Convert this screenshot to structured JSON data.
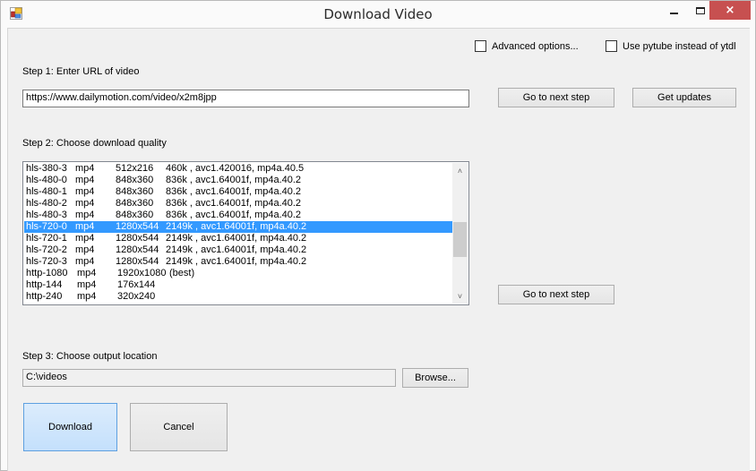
{
  "window": {
    "title": "Download Video",
    "controls": {
      "minimize": "minimize",
      "maximize": "maximize",
      "close": "×"
    },
    "icon": "app-icon"
  },
  "options": {
    "advanced_label": "Advanced options...",
    "advanced_checked": false,
    "pytube_label": "Use pytube instead of ytdl",
    "pytube_checked": false
  },
  "step1": {
    "label": "Step 1: Enter URL of video",
    "url_value": "https://www.dailymotion.com/video/x2m8jpp",
    "next_button": "Go to next step",
    "updates_button": "Get updates"
  },
  "step2": {
    "label": "Step 2: Choose download quality",
    "selected_index": 5,
    "scroll_position_fraction": 0.45,
    "formats": [
      {
        "id": "hls-380-3",
        "ext": "mp4",
        "resolution": "512x216",
        "note": "460k , avc1.420016, mp4a.40.5"
      },
      {
        "id": "hls-480-0",
        "ext": "mp4",
        "resolution": "848x360",
        "note": "836k , avc1.64001f, mp4a.40.2"
      },
      {
        "id": "hls-480-1",
        "ext": "mp4",
        "resolution": "848x360",
        "note": "836k , avc1.64001f, mp4a.40.2"
      },
      {
        "id": "hls-480-2",
        "ext": "mp4",
        "resolution": "848x360",
        "note": "836k , avc1.64001f, mp4a.40.2"
      },
      {
        "id": "hls-480-3",
        "ext": "mp4",
        "resolution": "848x360",
        "note": "836k , avc1.64001f, mp4a.40.2"
      },
      {
        "id": "hls-720-0",
        "ext": "mp4",
        "resolution": "1280x544",
        "note": "2149k , avc1.64001f, mp4a.40.2"
      },
      {
        "id": "hls-720-1",
        "ext": "mp4",
        "resolution": "1280x544",
        "note": "2149k , avc1.64001f, mp4a.40.2"
      },
      {
        "id": "hls-720-2",
        "ext": "mp4",
        "resolution": "1280x544",
        "note": "2149k , avc1.64001f, mp4a.40.2"
      },
      {
        "id": "hls-720-3",
        "ext": "mp4",
        "resolution": "1280x544",
        "note": "2149k , avc1.64001f, mp4a.40.2"
      },
      {
        "id": "http-1080",
        "ext": "mp4",
        "resolution": "1920x1080",
        "note": "(best)"
      },
      {
        "id": "http-144",
        "ext": "mp4",
        "resolution": "176x144",
        "note": ""
      },
      {
        "id": "http-240",
        "ext": "mp4",
        "resolution": "320x240",
        "note": ""
      }
    ],
    "next_button": "Go to next step"
  },
  "step3": {
    "label": "Step 3: Choose output location",
    "path_value": "C:\\videos",
    "browse_button": "Browse..."
  },
  "actions": {
    "download_button": "Download",
    "cancel_button": "Cancel"
  },
  "colors": {
    "selection": "#3399ff",
    "close_button": "#c75050",
    "primary_button_border": "#5ea0e0"
  }
}
